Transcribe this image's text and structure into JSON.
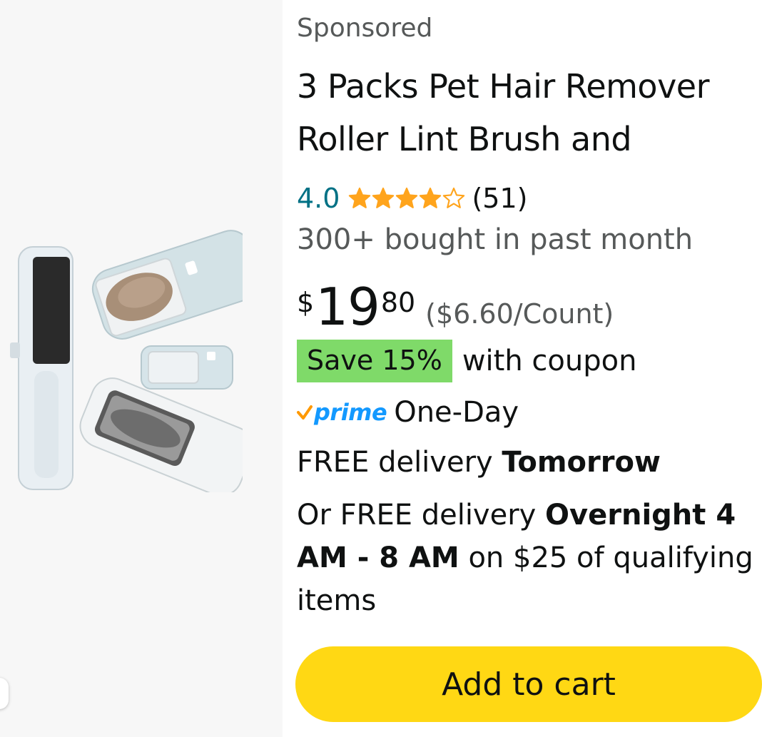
{
  "sponsored_label": "Sponsored",
  "product": {
    "title_line1": "3 Packs Pet Hair Remover",
    "title_line2": "Roller Lint Brush and",
    "rating": "4.0",
    "stars": 4,
    "stars_out_of": 5,
    "review_count": "(51)",
    "bought": "300+ bought in past month",
    "price": {
      "symbol": "$",
      "whole": "19",
      "fraction": "80",
      "unit_price": "($6.60/Count)"
    },
    "coupon": {
      "badge": "Save 15%",
      "text": "with coupon"
    },
    "prime": {
      "logo_text": "prime",
      "speed": "One-Day"
    },
    "delivery1": {
      "prefix": "FREE delivery ",
      "bold": "Tomorrow"
    },
    "delivery2": {
      "prefix": "Or FREE delivery ",
      "bold": "Overnight 4 AM - 8 AM",
      "suffix": " on $25 of qualifying items"
    }
  },
  "cart_button_label": "Add to cart",
  "colors": {
    "rating": "#007185",
    "star": "#ffa41c",
    "coupon_badge": "#7fda69",
    "prime": "#1399ff",
    "cart_button": "#ffd814",
    "image_bg": "#f7f7f7"
  }
}
